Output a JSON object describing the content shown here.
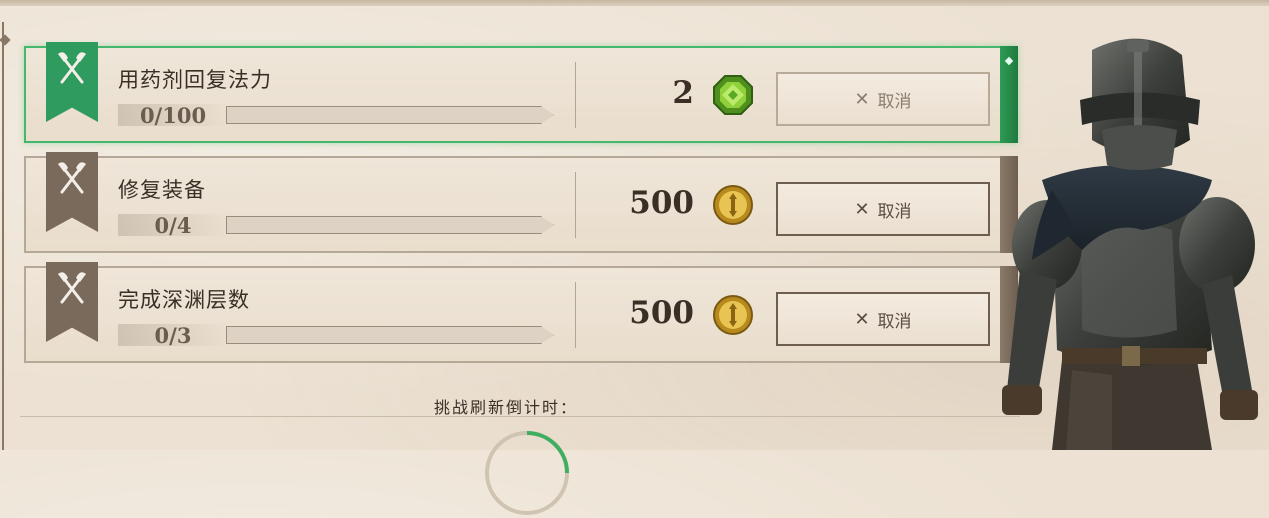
{
  "quests": [
    {
      "title": "用药剂回复法力",
      "progress_text": "0/100",
      "progress": 0,
      "reward_amount": "2",
      "reward_icon": "green-gem-icon",
      "cancel_label": "取消",
      "active": true
    },
    {
      "title": "修复装备",
      "progress_text": "0/4",
      "progress": 0,
      "reward_amount": "500",
      "reward_icon": "gold-coin-icon",
      "cancel_label": "取消",
      "active": false
    },
    {
      "title": "完成深渊层数",
      "progress_text": "0/3",
      "progress": 0,
      "reward_amount": "500",
      "reward_icon": "gold-coin-icon",
      "cancel_label": "取消",
      "active": false
    }
  ],
  "footer": {
    "countdown_label": "挑战刷新倒计时："
  },
  "colors": {
    "active_green": "#45b86e",
    "banner_gray": "#7a6a5b",
    "gold": "#d9b13d"
  }
}
